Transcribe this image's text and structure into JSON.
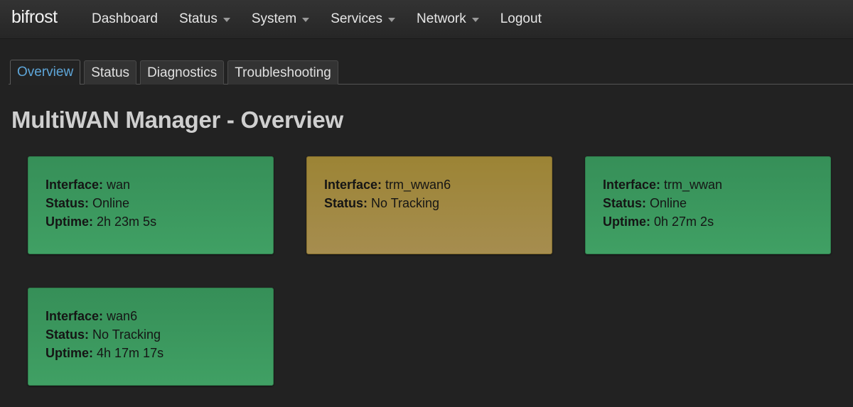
{
  "brand": "bifrost",
  "menu": [
    {
      "label": "Dashboard",
      "dropdown": false
    },
    {
      "label": "Status",
      "dropdown": true
    },
    {
      "label": "System",
      "dropdown": true
    },
    {
      "label": "Services",
      "dropdown": true
    },
    {
      "label": "Network",
      "dropdown": true
    },
    {
      "label": "Logout",
      "dropdown": false
    }
  ],
  "tabs": [
    {
      "label": "Overview",
      "active": true
    },
    {
      "label": "Status",
      "active": false
    },
    {
      "label": "Diagnostics",
      "active": false
    },
    {
      "label": "Troubleshooting",
      "active": false
    }
  ],
  "page_title": "MultiWAN Manager - Overview",
  "labels": {
    "interface": "Interface:",
    "status": "Status:",
    "uptime": "Uptime:"
  },
  "interfaces": [
    {
      "name": "wan",
      "status": "Online",
      "uptime": "2h 23m 5s",
      "color": "#3a9a5e"
    },
    {
      "name": "trm_wwan6",
      "status": "No Tracking",
      "color": "#a08a44"
    },
    {
      "name": "trm_wwan",
      "status": "Online",
      "uptime": "0h 27m 2s",
      "color": "#3a9a5e"
    },
    {
      "name": "wan6",
      "status": "No Tracking",
      "uptime": "4h 17m 17s",
      "color": "#3a9a5e"
    }
  ]
}
